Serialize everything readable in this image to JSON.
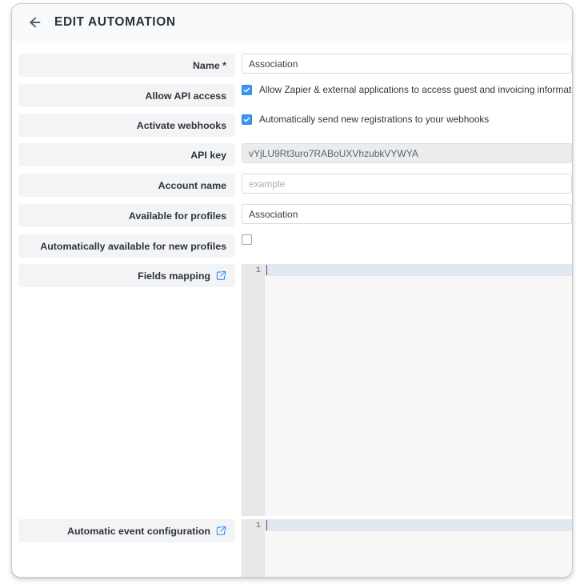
{
  "header": {
    "back_icon": "arrow-left-icon",
    "title": "EDIT AUTOMATION"
  },
  "form": {
    "rows": [
      {
        "label": "Name *",
        "type": "input",
        "value": "Association",
        "placeholder": "",
        "disabled": false
      },
      {
        "label": "Allow API access",
        "type": "checkbox",
        "checked": true,
        "checkbox_label": "Allow Zapier & external applications to access guest and invoicing information"
      },
      {
        "label": "Activate webhooks",
        "type": "checkbox",
        "checked": true,
        "checkbox_label": "Automatically send new registrations to your webhooks"
      },
      {
        "label": "API key",
        "type": "input",
        "value": "vYjLU9Rt3uro7RABoUXVhzubkVYWYA",
        "placeholder": "",
        "disabled": true
      },
      {
        "label": "Account name",
        "type": "input",
        "value": "",
        "placeholder": "example",
        "disabled": false
      },
      {
        "label": "Available for profiles",
        "type": "input",
        "value": "Association",
        "placeholder": "",
        "disabled": false
      },
      {
        "label": "Automatically available for new profiles",
        "type": "checkbox",
        "checked": false,
        "checkbox_label": ""
      },
      {
        "label": "Fields mapping",
        "type": "editor",
        "link_icon": "external-link-icon",
        "line_number": "1",
        "code": ""
      },
      {
        "label": "Automatic event configuration",
        "type": "editor",
        "link_icon": "external-link-icon",
        "line_number": "1",
        "code": ""
      }
    ]
  },
  "colors": {
    "accent": "#3b95f3",
    "label_bg": "#f3f4f6",
    "header_bg": "#f8f9fb",
    "editor_bg": "#f7f7f7",
    "gutter_bg": "#e8e8e8",
    "active_line": "#e2e8f0"
  }
}
